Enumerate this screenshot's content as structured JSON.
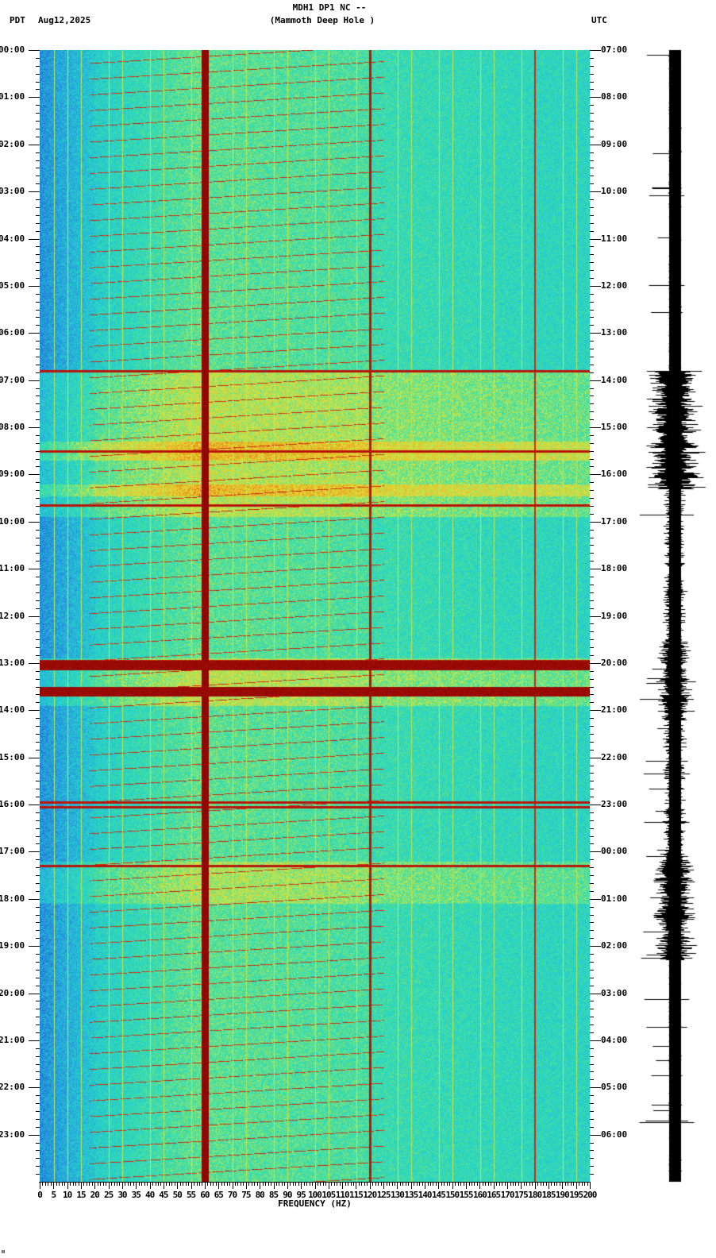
{
  "header": {
    "title": "MDH1 DP1 NC --",
    "subtitle": "(Mammoth Deep Hole )",
    "left_timezone": "PDT",
    "date": "Aug12,2025",
    "right_timezone": "UTC"
  },
  "footer_mark": "ᴍ",
  "chart_data": {
    "type": "heatmap",
    "title": "MDH1 DP1 NC -- (Mammoth Deep Hole )",
    "xlabel": "FREQUENCY (HZ)",
    "xlim": [
      0,
      200
    ],
    "x_ticks": [
      "0",
      "5",
      "10",
      "15",
      "20",
      "25",
      "30",
      "35",
      "40",
      "45",
      "50",
      "55",
      "60",
      "65",
      "70",
      "75",
      "80",
      "85",
      "90",
      "95",
      "100",
      "105",
      "110",
      "115",
      "120",
      "125",
      "130",
      "135",
      "140",
      "145",
      "150",
      "155",
      "160",
      "165",
      "170",
      "175",
      "180",
      "185",
      "190",
      "195",
      "200"
    ],
    "y_left_label": "PDT",
    "y_left_ticks": [
      "00:00",
      "01:00",
      "02:00",
      "03:00",
      "04:00",
      "05:00",
      "06:00",
      "07:00",
      "08:00",
      "09:00",
      "10:00",
      "11:00",
      "12:00",
      "13:00",
      "14:00",
      "15:00",
      "16:00",
      "17:00",
      "18:00",
      "19:00",
      "20:00",
      "21:00",
      "22:00",
      "23:00"
    ],
    "y_right_label": "UTC",
    "y_right_ticks": [
      "07:00",
      "08:00",
      "09:00",
      "10:00",
      "11:00",
      "12:00",
      "13:00",
      "14:00",
      "15:00",
      "16:00",
      "17:00",
      "18:00",
      "19:00",
      "20:00",
      "21:00",
      "22:00",
      "23:00",
      "00:00",
      "01:00",
      "02:00",
      "03:00",
      "04:00",
      "05:00",
      "06:00"
    ],
    "ylim_hours": [
      0,
      24
    ],
    "colormap": [
      "#1565c8",
      "#2a9be0",
      "#22d0d0",
      "#40e0a0",
      "#d8e840",
      "#f0b020",
      "#d02010",
      "#800000"
    ],
    "persistent_lines_hz": [
      60,
      120
    ],
    "broadband_events_hours_pdt": [
      6.8,
      8.5,
      9.65,
      12.95,
      13.1,
      13.6,
      15.95,
      16.05,
      17.3
    ],
    "legend": "none",
    "grid": true
  }
}
